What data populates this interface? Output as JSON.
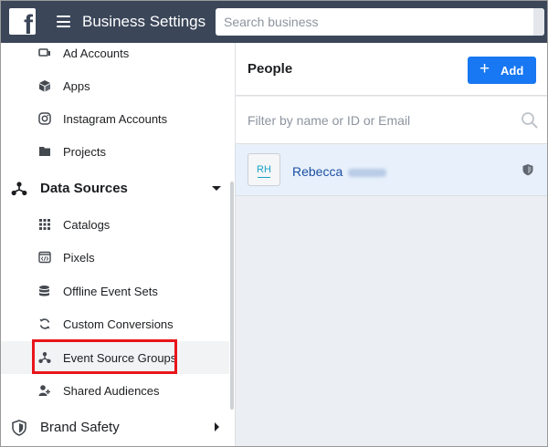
{
  "topbar": {
    "logo_letter": "f",
    "title": "Business Settings",
    "search_placeholder": "Search business"
  },
  "sidebar": {
    "items_top": [
      {
        "label": "Ad Accounts",
        "icon": "ad-accounts-icon"
      },
      {
        "label": "Apps",
        "icon": "apps-cube-icon"
      },
      {
        "label": "Instagram Accounts",
        "icon": "instagram-icon"
      },
      {
        "label": "Projects",
        "icon": "folder-icon"
      }
    ],
    "data_sources": {
      "label": "Data Sources",
      "icon": "data-sources-icon",
      "expanded": true,
      "items": [
        {
          "label": "Catalogs",
          "icon": "grid-icon"
        },
        {
          "label": "Pixels",
          "icon": "pixel-code-icon"
        },
        {
          "label": "Offline Event Sets",
          "icon": "database-icon"
        },
        {
          "label": "Custom Conversions",
          "icon": "refresh-arrows-icon"
        },
        {
          "label": "Event Source Groups",
          "icon": "event-source-icon",
          "active": true
        },
        {
          "label": "Shared Audiences",
          "icon": "audience-icon"
        }
      ]
    },
    "brand_safety": {
      "label": "Brand Safety",
      "icon": "shield-icon",
      "expanded": false
    }
  },
  "main": {
    "title": "People",
    "add_button_label": "Add",
    "filter_placeholder": "Filter by name or ID or Email",
    "people": [
      {
        "initials": "RH",
        "name": "Rebecca",
        "icon": "shield-small-icon"
      }
    ]
  },
  "colors": {
    "topbar": "#3b4659",
    "accent": "#1877f2",
    "selected_row": "#e7f0fb",
    "highlight": "#e8151b",
    "link": "#1d4fa3"
  }
}
